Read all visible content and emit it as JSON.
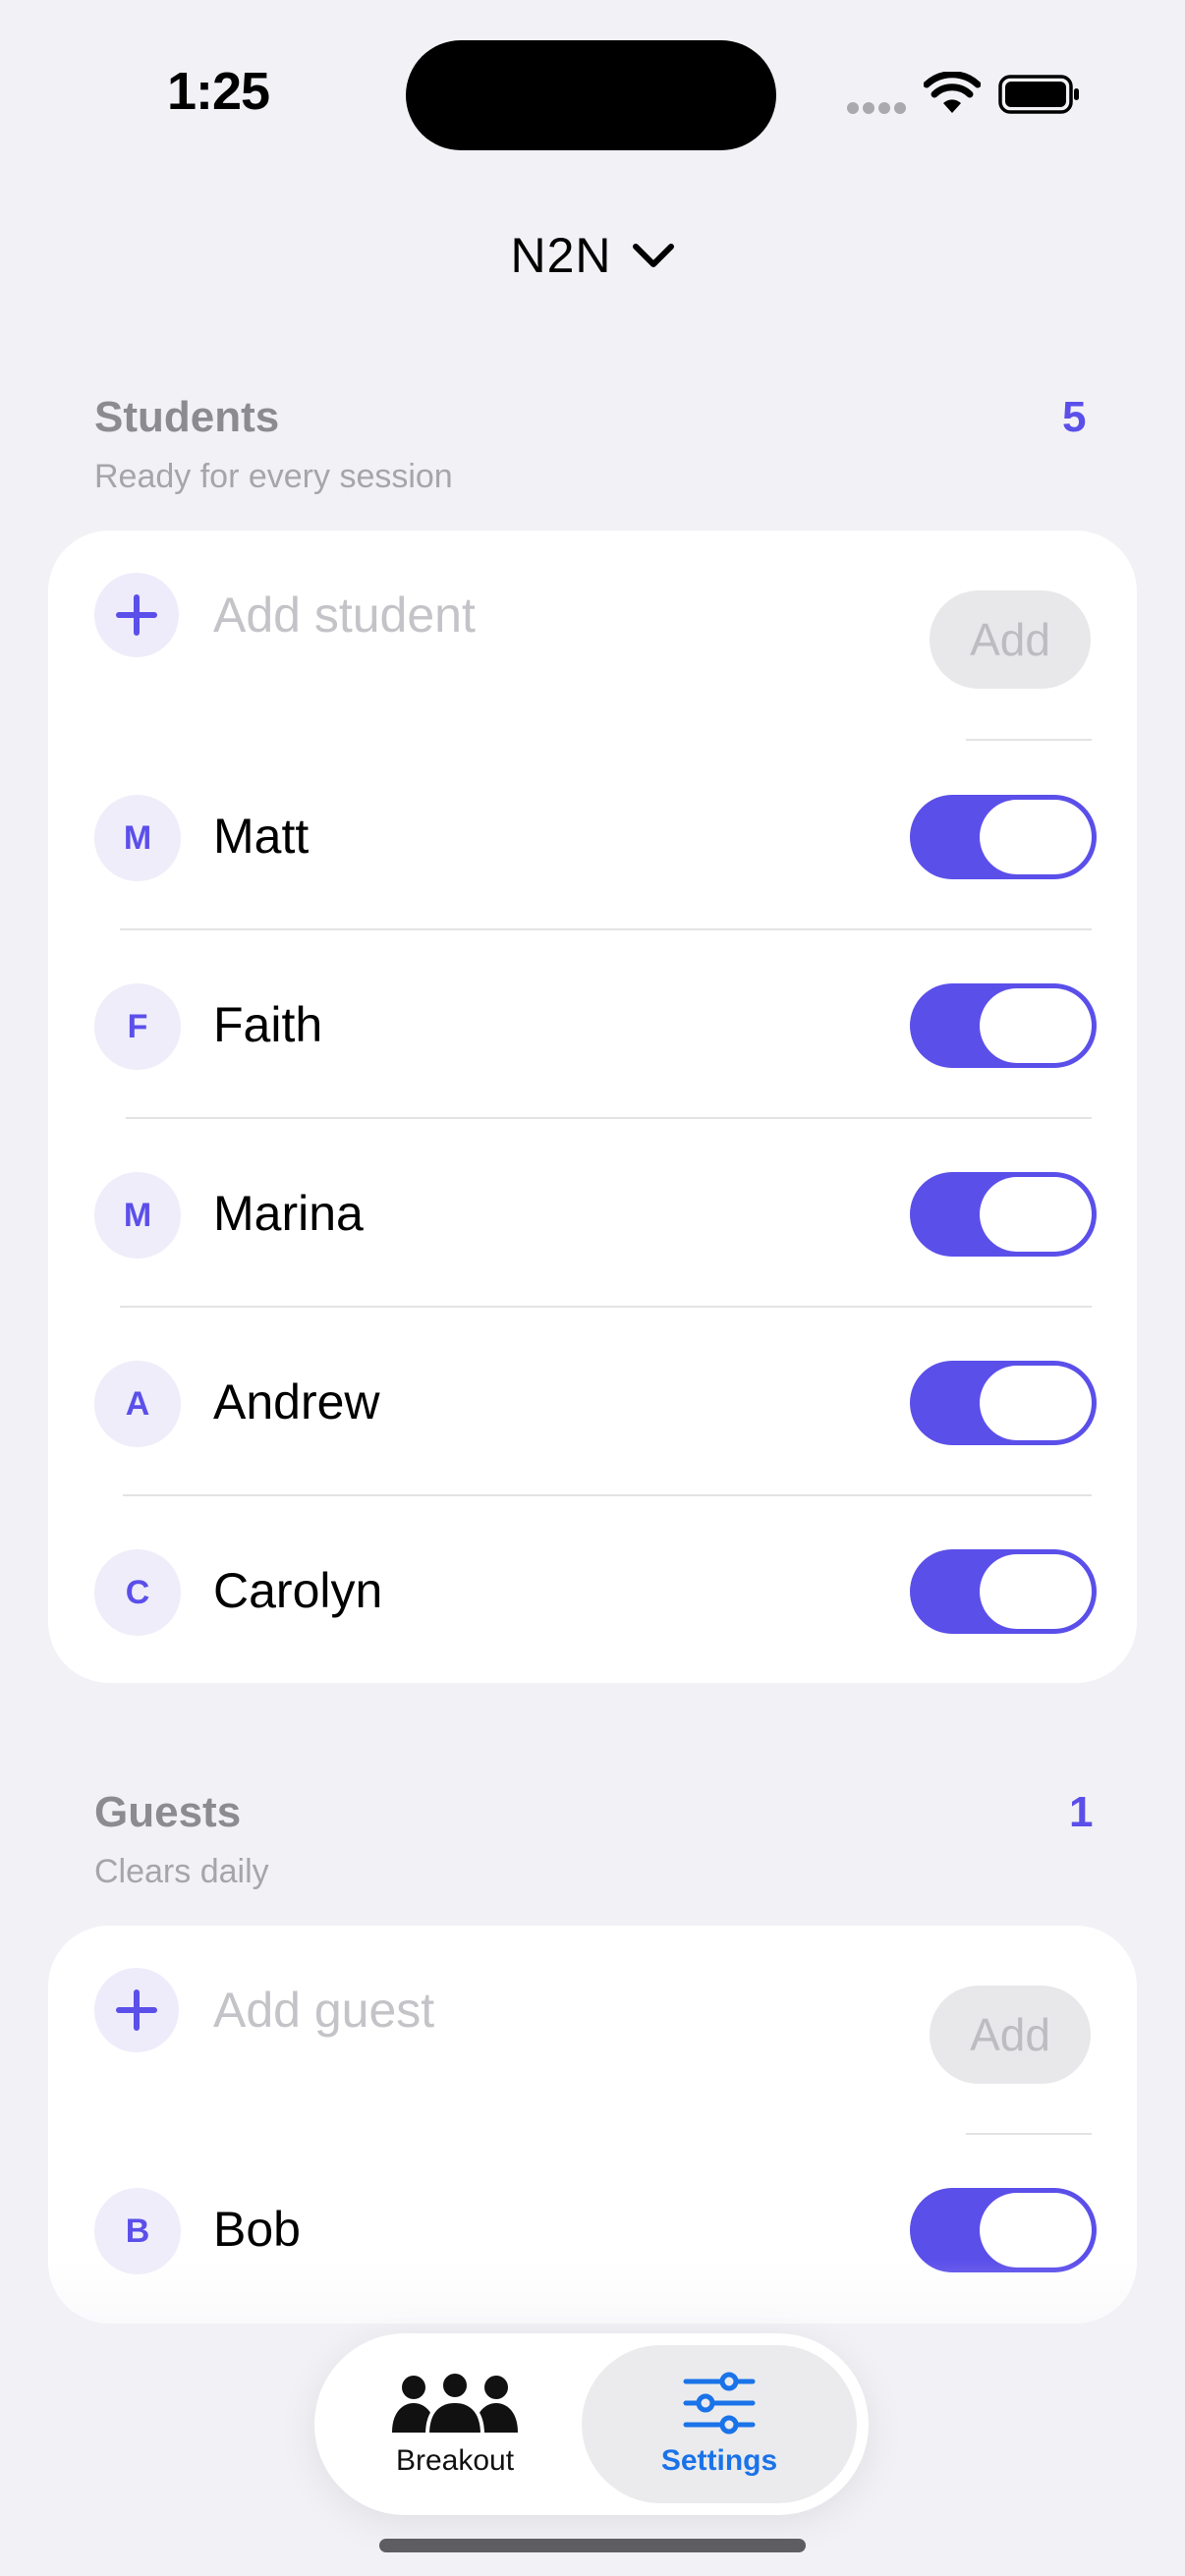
{
  "status_bar": {
    "time": "1:25",
    "icons": [
      "signal-dots-icon",
      "wifi-icon",
      "battery-icon"
    ]
  },
  "header": {
    "org_name": "N2N",
    "org_chevron": "chevron-down-icon"
  },
  "students": {
    "title": "Students",
    "subtitle": "Ready for every session",
    "count": "5",
    "add_placeholder": "Add student",
    "add_button": "Add",
    "items": [
      {
        "initial": "M",
        "name": "Matt",
        "enabled": true
      },
      {
        "initial": "F",
        "name": "Faith",
        "enabled": true
      },
      {
        "initial": "M",
        "name": "Marina",
        "enabled": true
      },
      {
        "initial": "A",
        "name": "Andrew",
        "enabled": true
      },
      {
        "initial": "C",
        "name": "Carolyn",
        "enabled": true
      }
    ]
  },
  "guests": {
    "title": "Guests",
    "subtitle": "Clears daily",
    "count": "1",
    "add_placeholder": "Add guest",
    "add_button": "Add",
    "items": [
      {
        "initial": "B",
        "name": "Bob",
        "enabled": true
      }
    ]
  },
  "tabbar": {
    "tabs": [
      {
        "label": "Breakout",
        "icon": "people-group-icon",
        "selected": false
      },
      {
        "label": "Settings",
        "icon": "sliders-icon",
        "selected": true
      }
    ]
  },
  "colors": {
    "accent": "#5B4FEA",
    "background": "#F2F1F6",
    "tab_selected": "#1A73E8"
  }
}
